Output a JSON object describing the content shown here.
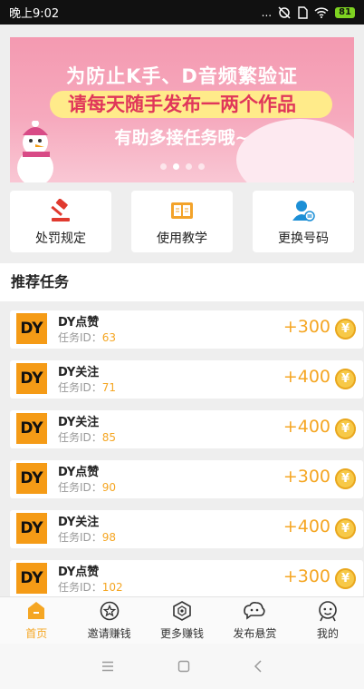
{
  "status_bar": {
    "time": "晚上9:02",
    "more": "...",
    "battery": "81"
  },
  "banner": {
    "line1": "为防止K手、D音频繁验证",
    "line2": "请每天随手发布一两个作品",
    "line3": "有助多接任务哦~",
    "pages": 4,
    "active_page": 1
  },
  "quick_actions": [
    {
      "label": "处罚规定",
      "icon": "gavel-icon"
    },
    {
      "label": "使用教学",
      "icon": "open-book-icon"
    },
    {
      "label": "更换号码",
      "icon": "user-swap-icon"
    }
  ],
  "section": {
    "title": "推荐任务"
  },
  "tasks": [
    {
      "logo": "DY",
      "name": "DY点赞",
      "id_label": "任务ID：",
      "id": "63",
      "reward": "+300",
      "coin": "¥"
    },
    {
      "logo": "DY",
      "name": "DY关注",
      "id_label": "任务ID：",
      "id": "71",
      "reward": "+400",
      "coin": "¥"
    },
    {
      "logo": "DY",
      "name": "DY关注",
      "id_label": "任务ID：",
      "id": "85",
      "reward": "+400",
      "coin": "¥"
    },
    {
      "logo": "DY",
      "name": "DY点赞",
      "id_label": "任务ID：",
      "id": "90",
      "reward": "+300",
      "coin": "¥"
    },
    {
      "logo": "DY",
      "name": "DY关注",
      "id_label": "任务ID：",
      "id": "98",
      "reward": "+400",
      "coin": "¥"
    },
    {
      "logo": "DY",
      "name": "DY点赞",
      "id_label": "任务ID：",
      "id": "102",
      "reward": "+300",
      "coin": "¥"
    }
  ],
  "tab_bar": [
    {
      "label": "首页",
      "icon": "home-icon",
      "active": true
    },
    {
      "label": "邀请赚钱",
      "icon": "invite-star-icon",
      "active": false
    },
    {
      "label": "更多赚钱",
      "icon": "hexagon-icon",
      "active": false
    },
    {
      "label": "发布悬赏",
      "icon": "chat-cloud-icon",
      "active": false
    },
    {
      "label": "我的",
      "icon": "profile-face-icon",
      "active": false
    }
  ],
  "colors": {
    "accent": "#f5a623",
    "banner_pink": "#f49ab1",
    "highlight_text": "#e0365a"
  }
}
